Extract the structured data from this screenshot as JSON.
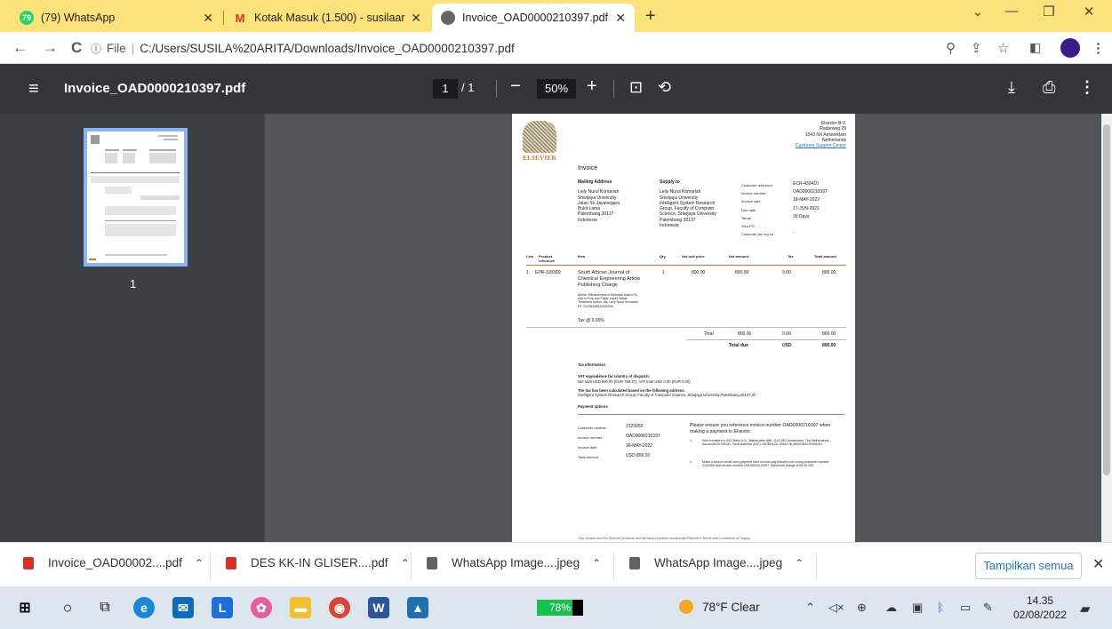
{
  "tabs": [
    {
      "label": "(79) WhatsApp",
      "icon": "whatsapp-icon",
      "badge": "79"
    },
    {
      "label": "Kotak Masuk (1.500) - susilaarita",
      "icon": "gmail-icon"
    },
    {
      "label": "Invoice_OAD0000210397.pdf",
      "icon": "globe-icon"
    }
  ],
  "address": {
    "prefix": "File",
    "url": "C:/Users/SUSILA%20ARITA/Downloads/Invoice_OAD0000210397.pdf"
  },
  "pdf_toolbar": {
    "title": "Invoice_OAD0000210397.pdf",
    "page": "1",
    "total": "/ 1",
    "zoom": "50%"
  },
  "sidebar": {
    "page_label": "1"
  },
  "doc": {
    "company": [
      "Elsevier B.V.",
      "Radarweg 29",
      "1043 NX Amsterdam",
      "Netherlands"
    ],
    "support": "Customer Support Center",
    "logo": "ELSEVIER",
    "heading": "Invoice",
    "mailing_title": "Mailing Address",
    "mailing": [
      "Leily Nurul Komariah",
      "Sriwijaya University",
      "Jalan Sri Jayanegara",
      "Bukit Lama",
      "Palembang 30127",
      "Indonesia"
    ],
    "supply_title": "Supply to",
    "supply": [
      "Leily Nurul Komariah",
      "Sriwijaya University",
      "Intelligent System Research",
      "Group, Faculty of Computer",
      "Science, Sriwijaya University",
      "Palembang 30137",
      "Indonesia"
    ],
    "meta_labels": [
      "Customer reference",
      "Invoice number",
      "Invoice date",
      "Due date",
      "Terms",
      "Your PO",
      "Customer tax reg no"
    ],
    "meta_values": [
      "ECR-439410",
      "OAD0000210397",
      "18-MAY-2022",
      "17-JUN-2022",
      "30 Days",
      "",
      "-"
    ],
    "table_headers": [
      "Line",
      "Product reference",
      "Item",
      "Qty",
      "Net unit price",
      "Net amount",
      "Tax",
      "Total amount"
    ],
    "row": {
      "line": "1",
      "ref": "EPR-100389",
      "item": "South African Journal of Chemical Engineering Article Publishing Charge",
      "qty": "1",
      "unit": "800.00",
      "net": "800.00",
      "tax": "0.00",
      "total": "800.00"
    },
    "row_detail": "Article: Effectiveness of Biomass-based Fly Ash in Pulp and Paper Liquid Waste Treatment Author: Ms. Leily Nurul Komariah PII: S1026918522000336",
    "tax_rate": "Tax @ 0.00%",
    "total_label": "Total",
    "total_net": "800.00",
    "total_tax": "0.00",
    "total_amount": "800.00",
    "due_label": "Total due",
    "due_currency": "USD",
    "due_amount": "800.00",
    "tax_info_title": "Tax information",
    "vat_title": "VAT equivalence for country of dispatch:",
    "vat_text": "Net total USD 800.00 (EUR 758.37), VAT total USD 0.00 (EUR 0.00)",
    "calc_title": "The tax has been calculated based on the following address:",
    "calc_text": "Intelligent System Research Group, Faculty of Computer Science, Sriwijaya University,Palembang,30137,ID",
    "payment_title": "Payment options",
    "pay_labels": [
      "Customer number",
      "Invoice number",
      "Invoice date",
      "Total amount"
    ],
    "pay_values": [
      "2129350",
      "OAD0000210397",
      "18-MAY-2022",
      "USD 800.00"
    ],
    "pay_note": "Please ensure you reference invoice number OAD0000210397 when making a payment to Elsevier.",
    "pay_opt1": "Wire transfers to ING Bank N.V., Bijlmerplein 888, 1102 MG Amsterdam, The Netherlands – Account# 20198181, Swift-Address (BIC): INGBNL2A, IBAN: NL46INGB0020198181.",
    "pay_opt2": "Make a secure credit card payment here invoice.pay.elsevier.com using customer number 2129350 and invoice number OAD0000210397. Maximum charge USD 50,000.",
    "footer": "This invoice and the Elsevier products and services provided incorporate Elsevier's Terms and Conditions of Supply."
  },
  "downloads": [
    {
      "label": "Invoice_OAD00002....pdf",
      "icon": "pdf-icon"
    },
    {
      "label": "DES KK-IN GLISER....pdf",
      "icon": "pdf-icon"
    },
    {
      "label": "WhatsApp Image....jpeg",
      "icon": "image-file-icon"
    },
    {
      "label": "WhatsApp Image....jpeg",
      "icon": "image-file-icon"
    }
  ],
  "show_all": "Tampilkan semua",
  "taskbar": {
    "battery": "78%",
    "weather": "78°F  Clear",
    "time": "14.35",
    "date": "02/08/2022"
  },
  "colors": {
    "tabstrip": "#fbe27a",
    "pdf_toolbar": "#323639",
    "viewer_bg": "#525659",
    "elsevier_orange": "#f36c21",
    "link": "#1a73e8"
  }
}
